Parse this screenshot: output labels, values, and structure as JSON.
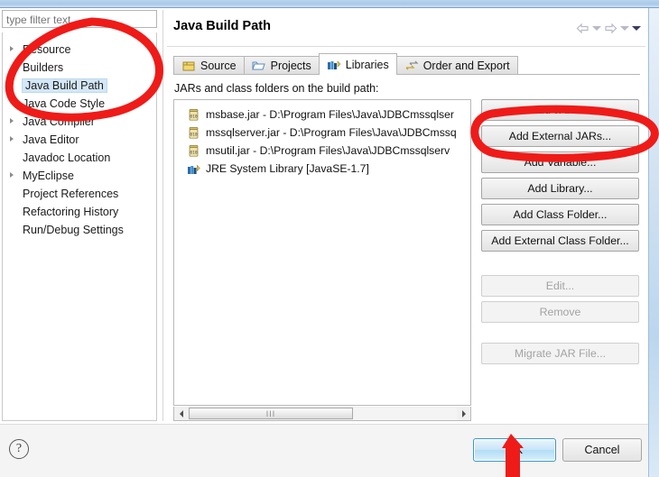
{
  "window": {
    "title_bar_color": "#a8c9e8"
  },
  "sidebar": {
    "filter": {
      "placeholder": "type filter text",
      "value": "type filter text"
    },
    "items": [
      {
        "label": "Resource",
        "expandable": true,
        "selected": false
      },
      {
        "label": "Builders",
        "expandable": false,
        "selected": false
      },
      {
        "label": "Java Build Path",
        "expandable": false,
        "selected": true
      },
      {
        "label": "Java Code Style",
        "expandable": false,
        "selected": false
      },
      {
        "label": "Java Compiler",
        "expandable": true,
        "selected": false
      },
      {
        "label": "Java Editor",
        "expandable": true,
        "selected": false
      },
      {
        "label": "Javadoc Location",
        "expandable": false,
        "selected": false
      },
      {
        "label": "MyEclipse",
        "expandable": true,
        "selected": false
      },
      {
        "label": "Project References",
        "expandable": false,
        "selected": false
      },
      {
        "label": "Refactoring History",
        "expandable": false,
        "selected": false
      },
      {
        "label": "Run/Debug Settings",
        "expandable": false,
        "selected": false
      }
    ]
  },
  "page": {
    "title": "Java Build Path",
    "nav": {
      "back_icon": "back-arrow-icon",
      "back_caret_icon": "chevron-down-icon",
      "forward_icon": "forward-arrow-icon",
      "forward_caret_icon": "chevron-down-icon",
      "menu_caret_icon": "chevron-down-icon"
    },
    "tabs": [
      {
        "label": "Source",
        "icon": "source-package-icon",
        "active": false
      },
      {
        "label": "Projects",
        "icon": "folder-icon",
        "active": false
      },
      {
        "label": "Libraries",
        "icon": "books-icon",
        "active": true
      },
      {
        "label": "Order and Export",
        "icon": "order-export-icon",
        "active": false
      }
    ],
    "content_label": "JARs and class folders on the build path:",
    "entries": [
      {
        "icon": "jar-icon",
        "label": "msbase.jar - D:\\Program Files\\Java\\JDBCmssqlser"
      },
      {
        "icon": "jar-icon",
        "label": "mssqlserver.jar - D:\\Program Files\\Java\\JDBCmssq"
      },
      {
        "icon": "jar-icon",
        "label": "msutil.jar - D:\\Program Files\\Java\\JDBCmssqlserv"
      },
      {
        "icon": "library-icon",
        "label": "JRE System Library [JavaSE-1.7]"
      }
    ],
    "scrollbar": {
      "left_icon": "scroll-left-icon",
      "right_icon": "scroll-right-icon",
      "grip": "III"
    },
    "buttons": [
      {
        "label": "Add JARs...",
        "enabled": true,
        "gap": ""
      },
      {
        "label": "Add External JARs...",
        "enabled": true,
        "gap": ""
      },
      {
        "label": "Add Variable...",
        "enabled": true,
        "gap": ""
      },
      {
        "label": "Add Library...",
        "enabled": true,
        "gap": ""
      },
      {
        "label": "Add Class Folder...",
        "enabled": true,
        "gap": ""
      },
      {
        "label": "Add External Class Folder...",
        "enabled": true,
        "gap": ""
      },
      {
        "label": "Edit...",
        "enabled": false,
        "gap": "gap-lg"
      },
      {
        "label": "Remove",
        "enabled": false,
        "gap": ""
      },
      {
        "label": "Migrate JAR File...",
        "enabled": false,
        "gap": "gap-md"
      }
    ]
  },
  "footer": {
    "help_icon": "help-question-icon",
    "help_glyph": "?",
    "ok_label": "OK",
    "cancel_label": "Cancel"
  },
  "annotations": {
    "color": "#ef1b18",
    "shapes": [
      "ellipse-around-sidebar-java-build-path",
      "ellipse-around-add-external-jars-button",
      "arrow-pointing-to-ok-button"
    ]
  }
}
